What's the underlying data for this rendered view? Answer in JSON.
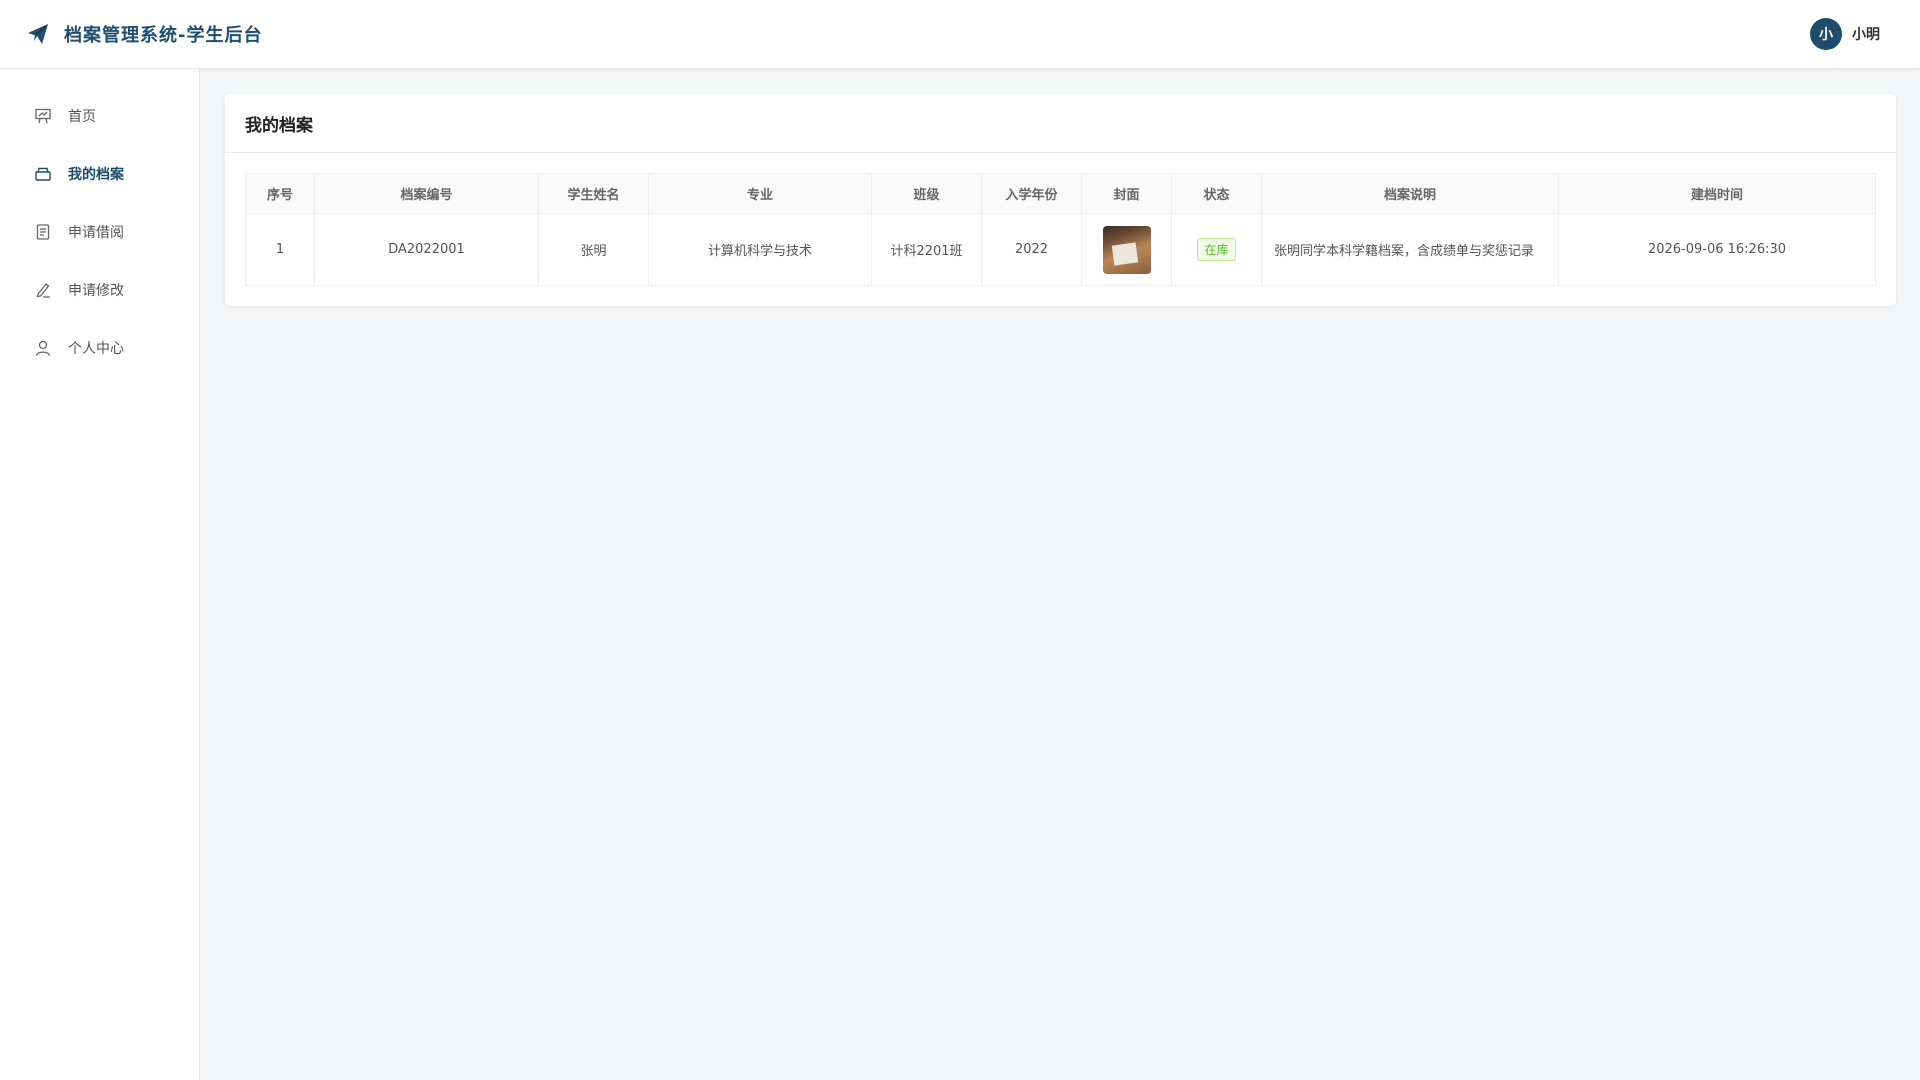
{
  "header": {
    "title": "档案管理系统-学生后台",
    "user": {
      "avatar_text": "小",
      "name": "小明"
    }
  },
  "sidebar": {
    "items": [
      {
        "label": "首页",
        "icon": "presentation-icon",
        "active": false
      },
      {
        "label": "我的档案",
        "icon": "archive-box-icon",
        "active": true
      },
      {
        "label": "申请借阅",
        "icon": "document-icon",
        "active": false
      },
      {
        "label": "申请修改",
        "icon": "pen-edit-icon",
        "active": false
      },
      {
        "label": "个人中心",
        "icon": "user-icon",
        "active": false
      }
    ]
  },
  "main": {
    "card_title": "我的档案",
    "table": {
      "columns": [
        "序号",
        "档案编号",
        "学生姓名",
        "专业",
        "班级",
        "入学年份",
        "封面",
        "状态",
        "档案说明",
        "建档时间"
      ],
      "rows": [
        {
          "index": "1",
          "archive_no": "DA2022001",
          "student_name": "张明",
          "major": "计算机科学与技术",
          "class": "计科2201班",
          "enroll_year": "2022",
          "status": "在库",
          "description": "张明同学本科学籍档案，含成绩单与奖惩记录",
          "created_at": "2026-09-06 16:26:30"
        }
      ]
    }
  },
  "colors": {
    "brand": "#1f4e6e",
    "avatar_bg": "#1e4d6b",
    "status_green": "#52c41a"
  }
}
